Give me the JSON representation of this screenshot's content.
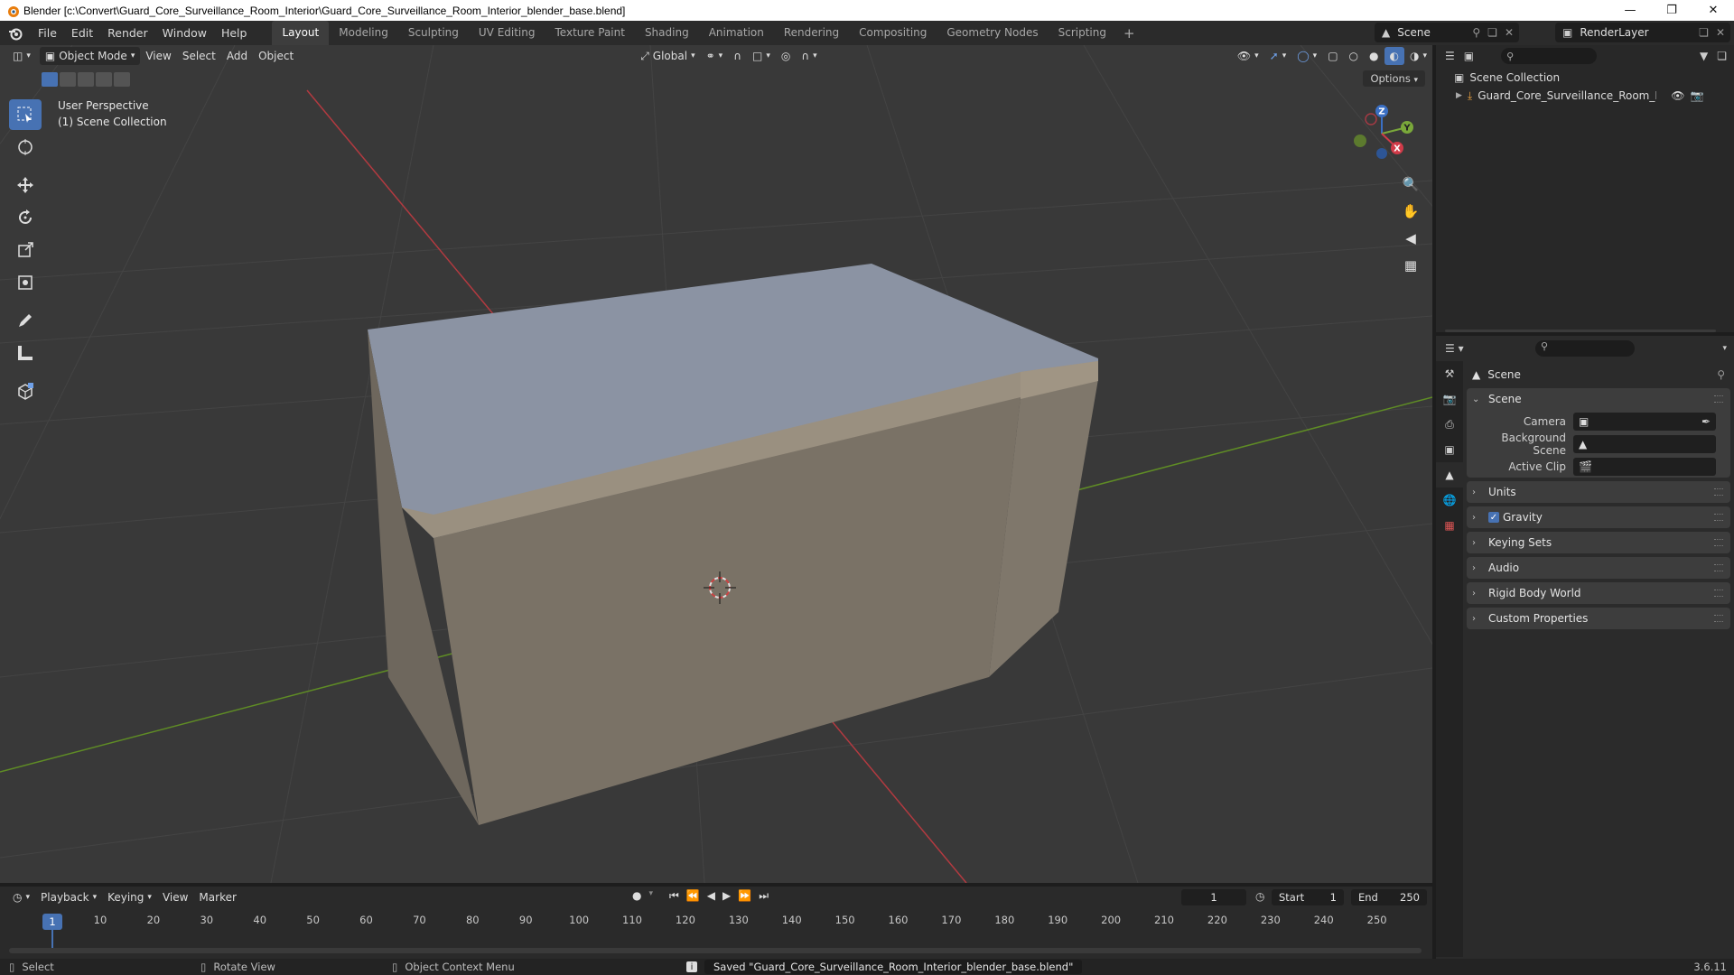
{
  "window": {
    "title": "Blender [c:\\Convert\\Guard_Core_Surveillance_Room_Interior\\Guard_Core_Surveillance_Room_Interior_blender_base.blend]",
    "controls": [
      "minimize",
      "maximize",
      "close"
    ]
  },
  "menu": {
    "items": [
      "File",
      "Edit",
      "Render",
      "Window",
      "Help"
    ]
  },
  "workspaces": {
    "tabs": [
      "Layout",
      "Modeling",
      "Sculpting",
      "UV Editing",
      "Texture Paint",
      "Shading",
      "Animation",
      "Rendering",
      "Compositing",
      "Geometry Nodes",
      "Scripting"
    ],
    "active": "Layout"
  },
  "scene_selector": {
    "value": "Scene"
  },
  "layer_selector": {
    "value": "RenderLayer"
  },
  "viewport": {
    "mode": "Object Mode",
    "menus": [
      "View",
      "Select",
      "Add",
      "Object"
    ],
    "transform_orientation": "Global",
    "options_label": "Options",
    "info_line1": "User Perspective",
    "info_line2": "(1) Scene Collection",
    "tools": [
      "select-box",
      "cursor",
      "move",
      "rotate",
      "scale",
      "transform",
      "annotate",
      "measure",
      "add-cube"
    ],
    "gizmo_axes": [
      "X",
      "Y",
      "Z"
    ],
    "colors": {
      "background": "#3a3a3a",
      "x_axis": "#c0393f",
      "y_axis": "#6a9a2a",
      "object_top": "#8a93a6",
      "object_front": "#7c7468"
    }
  },
  "outliner": {
    "root": "Scene Collection",
    "items": [
      {
        "name": "Guard_Core_Surveillance_Room_Interior"
      }
    ]
  },
  "properties": {
    "context": "Scene",
    "scene_panel": {
      "title": "Scene",
      "camera_label": "Camera",
      "camera_value": "",
      "background_scene_label": "Background Scene",
      "background_scene_value": "",
      "active_clip_label": "Active Clip",
      "active_clip_value": ""
    },
    "collapsed_panels": [
      "Units",
      "Gravity",
      "Keying Sets",
      "Audio",
      "Rigid Body World",
      "Custom Properties"
    ],
    "gravity_checked": true
  },
  "timeline": {
    "menus": [
      "Playback",
      "Keying",
      "View",
      "Marker"
    ],
    "current_frame": "1",
    "start_label": "Start",
    "start_value": "1",
    "end_label": "End",
    "end_value": "250",
    "ruler": [
      "1",
      "10",
      "20",
      "30",
      "40",
      "50",
      "60",
      "70",
      "80",
      "90",
      "100",
      "110",
      "120",
      "130",
      "140",
      "150",
      "160",
      "170",
      "180",
      "190",
      "200",
      "210",
      "220",
      "230",
      "240",
      "250"
    ]
  },
  "statusbar": {
    "select": "Select",
    "rotate_view": "Rotate View",
    "context_menu": "Object Context Menu",
    "message": "Saved \"Guard_Core_Surveillance_Room_Interior_blender_base.blend\"",
    "version": "3.6.11"
  }
}
